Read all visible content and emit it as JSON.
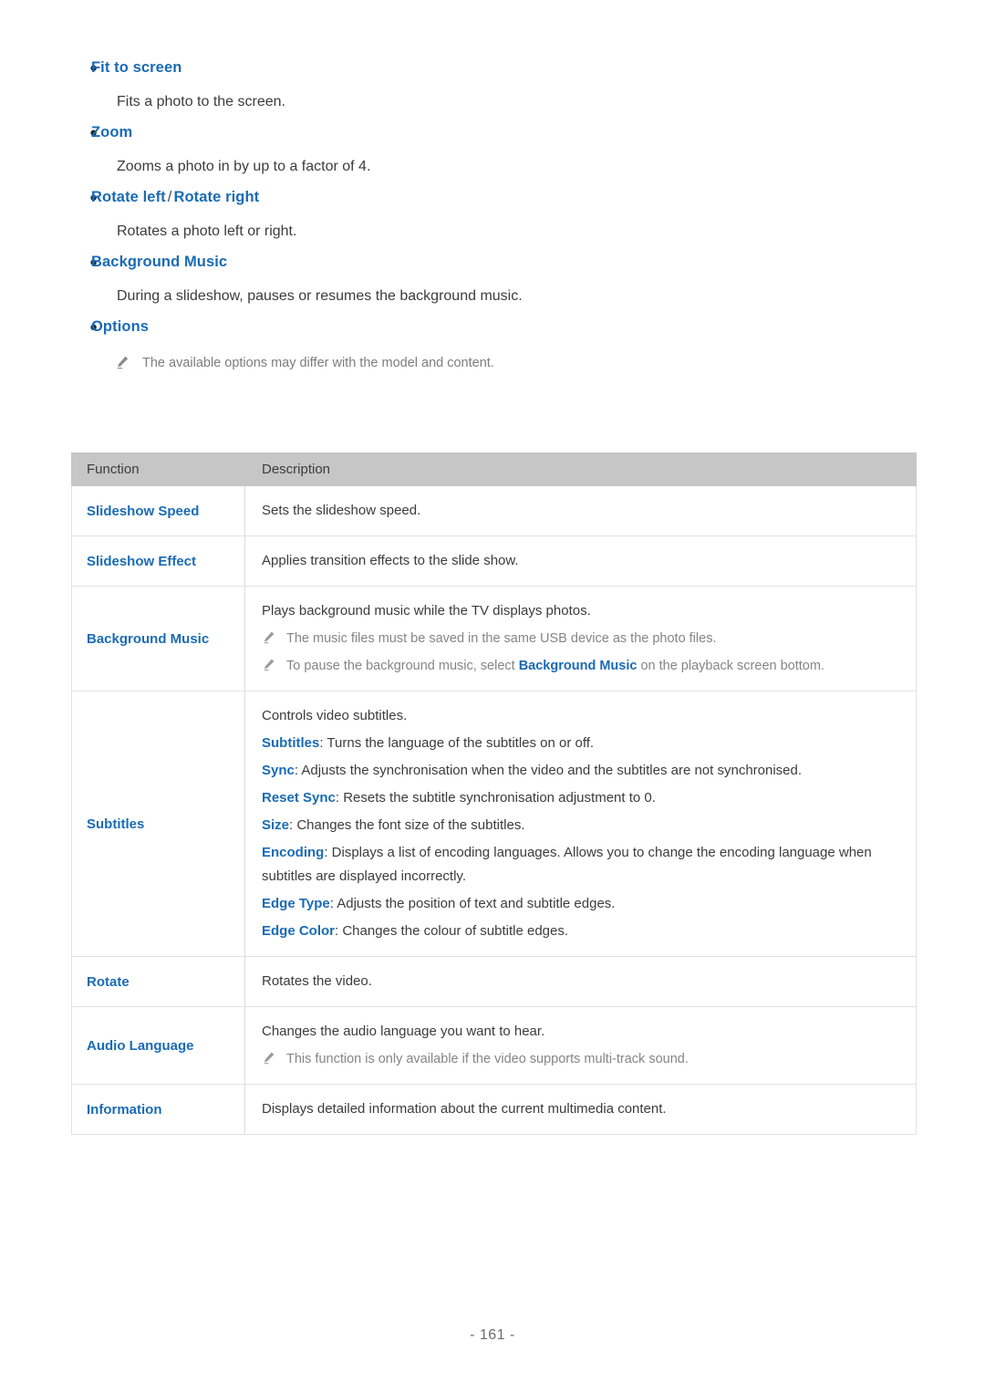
{
  "bullets": [
    {
      "title": "Fit to screen",
      "title2": null,
      "body": "Fits a photo to the screen."
    },
    {
      "title": "Zoom",
      "title2": null,
      "body": "Zooms a photo in by up to a factor of 4."
    },
    {
      "title": "Rotate left",
      "separator": "/",
      "title2": "Rotate right",
      "body": "Rotates a photo left or right."
    },
    {
      "title": "Background Music",
      "title2": null,
      "body": "During a slideshow, pauses or resumes the background music."
    },
    {
      "title": "Options",
      "title2": null,
      "body": null
    }
  ],
  "options_note": "The available options may differ with the model and content.",
  "table": {
    "headers": [
      "Function",
      "Description"
    ],
    "rows": [
      {
        "function": "Slideshow Speed",
        "lines": [
          {
            "type": "text",
            "text": "Sets the slideshow speed."
          }
        ]
      },
      {
        "function": "Slideshow Effect",
        "lines": [
          {
            "type": "text",
            "text": "Applies transition effects to the slide show."
          }
        ]
      },
      {
        "function": "Background Music",
        "lines": [
          {
            "type": "text",
            "text": "Plays background music while the TV displays photos."
          },
          {
            "type": "note",
            "text": "The music files must be saved in the same USB device as the photo files."
          },
          {
            "type": "note-rich",
            "pre": "To pause the background music, select ",
            "term": "Background Music",
            "post": " on the playback screen bottom."
          }
        ]
      },
      {
        "function": "Subtitles",
        "lines": [
          {
            "type": "text",
            "text": "Controls video subtitles."
          },
          {
            "type": "term",
            "term": "Subtitles",
            "text": ": Turns the language of the subtitles on or off."
          },
          {
            "type": "term",
            "term": "Sync",
            "text": ": Adjusts the synchronisation when the video and the subtitles are not synchronised."
          },
          {
            "type": "term",
            "term": "Reset Sync",
            "text": ": Resets the subtitle synchronisation adjustment to 0."
          },
          {
            "type": "term",
            "term": "Size",
            "text": ": Changes the font size of the subtitles."
          },
          {
            "type": "term",
            "term": "Encoding",
            "text": ": Displays a list of encoding languages. Allows you to change the encoding language when subtitles are displayed incorrectly."
          },
          {
            "type": "term",
            "term": "Edge Type",
            "text": ": Adjusts the position of text and subtitle edges."
          },
          {
            "type": "term",
            "term": "Edge Color",
            "text": ": Changes the colour of subtitle edges."
          }
        ]
      },
      {
        "function": "Rotate",
        "lines": [
          {
            "type": "text",
            "text": "Rotates the video."
          }
        ]
      },
      {
        "function": "Audio Language",
        "lines": [
          {
            "type": "text",
            "text": "Changes the audio language you want to hear."
          },
          {
            "type": "note",
            "text": "This function is only available if the video supports multi-track sound."
          }
        ]
      },
      {
        "function": "Information",
        "lines": [
          {
            "type": "text",
            "text": "Displays detailed information about the current multimedia content."
          }
        ]
      }
    ]
  },
  "footer": {
    "page_number": "- 161 -"
  },
  "colors": {
    "link": "#1a6bb5",
    "body_text": "#3c3c3c",
    "note_text": "#858585",
    "table_header_bg": "#c6c6c6",
    "table_border": "#e2e2e6"
  }
}
